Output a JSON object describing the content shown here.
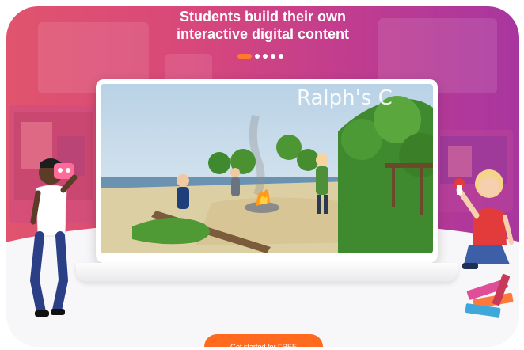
{
  "hero": {
    "headline_line1": "Students build their own",
    "headline_line2": "interactive digital content",
    "carousel": {
      "slide_count": 5,
      "active_index": 0
    }
  },
  "scene": {
    "sign_text": "Ralph's C"
  },
  "cta": {
    "label": "Get started for FREE"
  },
  "colors": {
    "hero_gradient_left": "#e0546e",
    "hero_gradient_right": "#a8369f",
    "accent_orange": "#ff6a1f",
    "page_background": "#f7f6f8"
  },
  "icons": [
    "vr-headset-icon"
  ]
}
